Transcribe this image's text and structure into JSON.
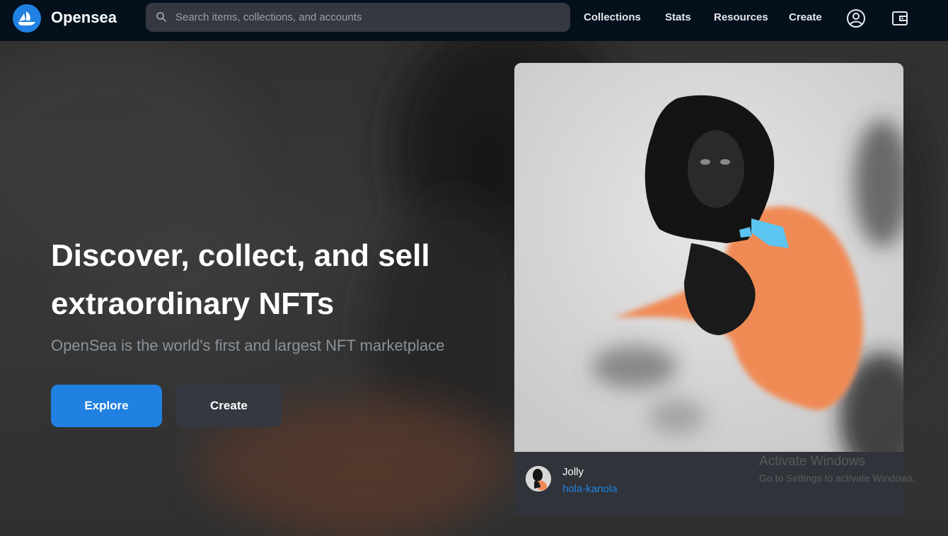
{
  "nav": {
    "brand": "Opensea",
    "search_placeholder": "Search items, collections, and accounts",
    "links": [
      "Collections",
      "Stats",
      "Resources",
      "Create"
    ],
    "icons": [
      "account-icon",
      "wallet-icon"
    ]
  },
  "hero": {
    "headline_line1": "Discover, collect, and sell",
    "headline_line2": "extraordinary NFTs",
    "subtitle": "OpenSea is the world's first and largest NFT marketplace",
    "explore_label": "Explore",
    "create_label": "Create"
  },
  "featured": {
    "name": "Jolly",
    "creator": "hola-kanola"
  },
  "watermark": {
    "title": "Activate Windows",
    "subtitle": "Go to Settings to activate Windows."
  },
  "colors": {
    "nav_bg": "#04111d",
    "accent": "#2081e2",
    "button_dark": "#353840",
    "muted_text": "#8a939b"
  }
}
